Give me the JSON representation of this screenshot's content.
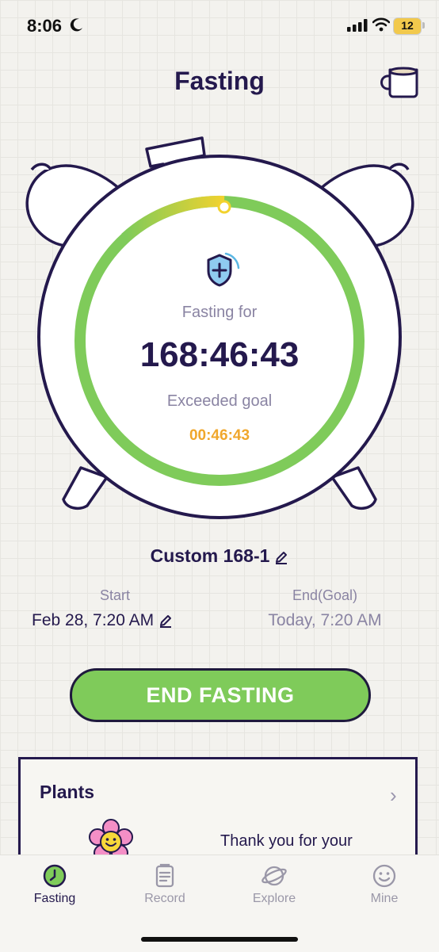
{
  "status": {
    "time": "8:06",
    "battery": "12"
  },
  "header": {
    "title": "Fasting"
  },
  "timer": {
    "label": "Fasting for",
    "elapsed": "168:46:43",
    "status_label": "Exceeded goal",
    "exceeded_time": "00:46:43",
    "progress_fraction": 1.0
  },
  "plan": {
    "name": "Custom 168-1",
    "start_label": "Start",
    "start_value": "Feb 28, 7:20 AM",
    "end_label": "End(Goal)",
    "end_value": "Today, 7:20 AM"
  },
  "action": {
    "end_label": "END FASTING"
  },
  "plants": {
    "title": "Plants",
    "message": "Thank you for your"
  },
  "tabs": [
    {
      "label": "Fasting",
      "icon": "clock-icon",
      "active": true
    },
    {
      "label": "Record",
      "icon": "clipboard-icon",
      "active": false
    },
    {
      "label": "Explore",
      "icon": "planet-icon",
      "active": false
    },
    {
      "label": "Mine",
      "icon": "smiley-icon",
      "active": false
    }
  ],
  "colors": {
    "primary_text": "#24194d",
    "muted_text": "#8a84a3",
    "ring_green": "#7fcb5a",
    "ring_yellow": "#f2d22e",
    "exceeded_orange": "#f0a72c",
    "button_green": "#7fcb5a"
  }
}
